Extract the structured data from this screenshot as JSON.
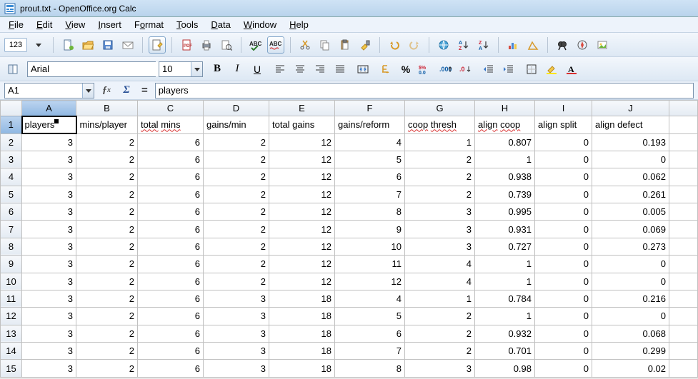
{
  "titlebar": {
    "title": "prout.txt - OpenOffice.org Calc"
  },
  "menus": [
    "File",
    "Edit",
    "View",
    "Insert",
    "Format",
    "Tools",
    "Data",
    "Window",
    "Help"
  ],
  "menu_underline_index": [
    0,
    0,
    0,
    0,
    1,
    0,
    0,
    0,
    0
  ],
  "toolbar_mode_box": "123",
  "formatbar": {
    "font_name": "Arial",
    "font_size": "10"
  },
  "formulabar": {
    "cell_ref": "A1",
    "formula": "players"
  },
  "columns": [
    "A",
    "B",
    "C",
    "D",
    "E",
    "F",
    "G",
    "H",
    "I",
    "J"
  ],
  "selected_col_index": 0,
  "selected_row_index": 0,
  "header_row": [
    "players",
    "mins/player",
    "total mins",
    "gains/min",
    "total gains",
    "gains/reform",
    "coop thresh",
    "align coop",
    "align split",
    "align defect"
  ],
  "header_redwave": [
    false,
    false,
    true,
    false,
    false,
    false,
    true,
    true,
    false,
    false
  ],
  "rows": [
    [
      "3",
      "2",
      "6",
      "2",
      "12",
      "4",
      "1",
      "0.807",
      "0",
      "0.193"
    ],
    [
      "3",
      "2",
      "6",
      "2",
      "12",
      "5",
      "2",
      "1",
      "0",
      "0"
    ],
    [
      "3",
      "2",
      "6",
      "2",
      "12",
      "6",
      "2",
      "0.938",
      "0",
      "0.062"
    ],
    [
      "3",
      "2",
      "6",
      "2",
      "12",
      "7",
      "2",
      "0.739",
      "0",
      "0.261"
    ],
    [
      "3",
      "2",
      "6",
      "2",
      "12",
      "8",
      "3",
      "0.995",
      "0",
      "0.005"
    ],
    [
      "3",
      "2",
      "6",
      "2",
      "12",
      "9",
      "3",
      "0.931",
      "0",
      "0.069"
    ],
    [
      "3",
      "2",
      "6",
      "2",
      "12",
      "10",
      "3",
      "0.727",
      "0",
      "0.273"
    ],
    [
      "3",
      "2",
      "6",
      "2",
      "12",
      "11",
      "4",
      "1",
      "0",
      "0"
    ],
    [
      "3",
      "2",
      "6",
      "2",
      "12",
      "12",
      "4",
      "1",
      "0",
      "0"
    ],
    [
      "3",
      "2",
      "6",
      "3",
      "18",
      "4",
      "1",
      "0.784",
      "0",
      "0.216"
    ],
    [
      "3",
      "2",
      "6",
      "3",
      "18",
      "5",
      "2",
      "1",
      "0",
      "0"
    ],
    [
      "3",
      "2",
      "6",
      "3",
      "18",
      "6",
      "2",
      "0.932",
      "0",
      "0.068"
    ],
    [
      "3",
      "2",
      "6",
      "3",
      "18",
      "7",
      "2",
      "0.701",
      "0",
      "0.299"
    ],
    [
      "3",
      "2",
      "6",
      "3",
      "18",
      "8",
      "3",
      "0.98",
      "0",
      "0.02"
    ]
  ]
}
